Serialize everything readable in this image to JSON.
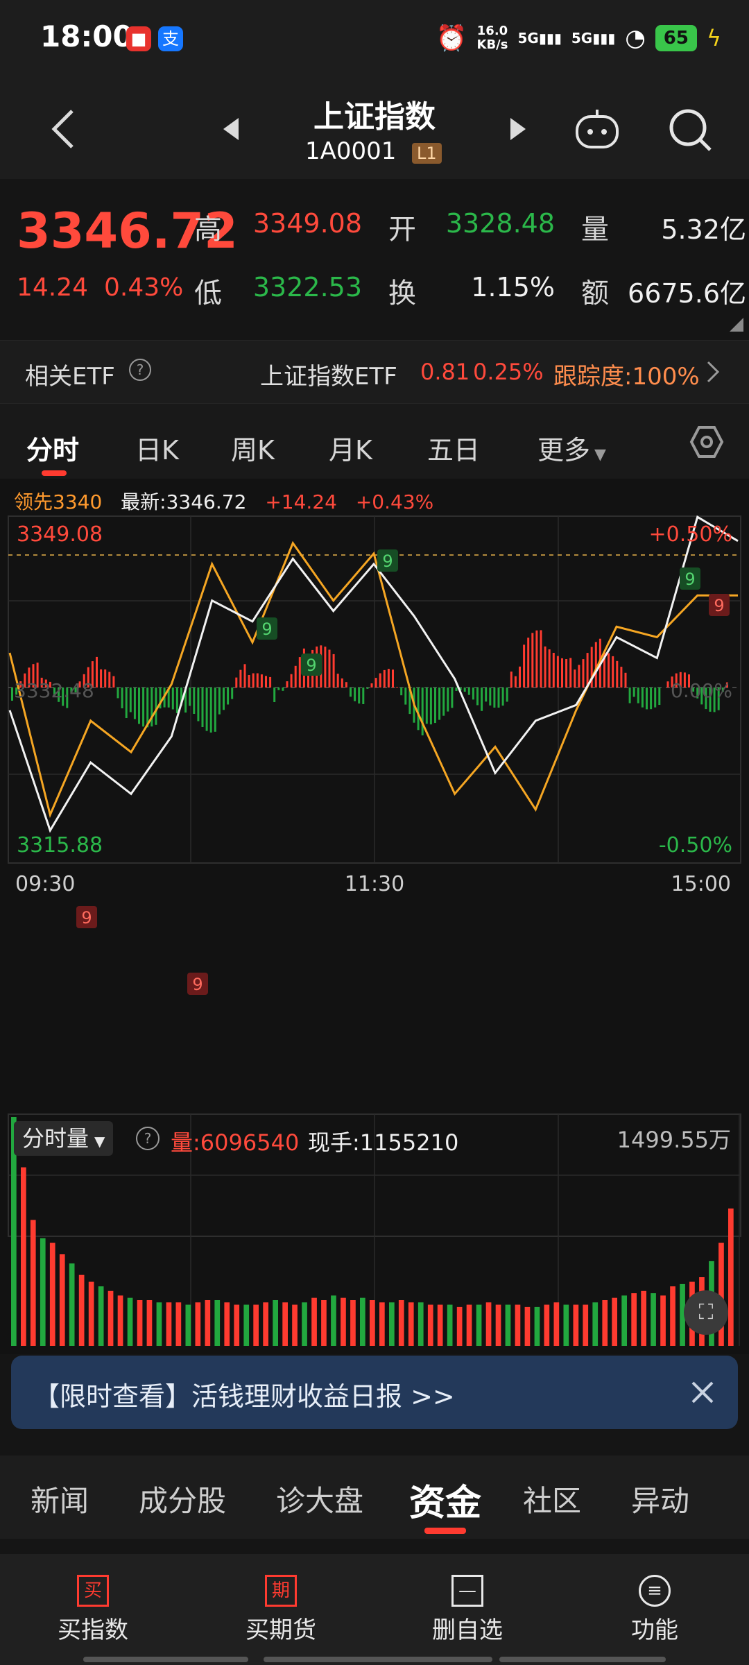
{
  "status_bar": {
    "time": "18:00",
    "speed_top": "16.0",
    "speed_unit": "KB/s",
    "net1": "5G",
    "net2": "5G",
    "battery": "65"
  },
  "header": {
    "title": "上证指数",
    "code": "1A0001",
    "level_badge": "L1"
  },
  "quote": {
    "price": "3346.72",
    "change": "14.24",
    "change_pct": "0.43%",
    "high_label": "高",
    "high": "3349.08",
    "open_label": "开",
    "open": "3328.48",
    "volume_label": "量",
    "volume": "5.32亿",
    "low_label": "低",
    "low": "3322.53",
    "turnover_label": "换",
    "turnover": "1.15%",
    "amount_label": "额",
    "amount": "6675.6亿"
  },
  "etf": {
    "label": "相关ETF",
    "name": "上证指数ETF",
    "price": "0.81",
    "pct": "0.25%",
    "tracking": "跟踪度:100%"
  },
  "tabs": [
    "分时",
    "日K",
    "周K",
    "月K",
    "五日",
    "更多"
  ],
  "chart_info": {
    "leader": "领先3340",
    "latest": "最新:3346.72",
    "change": "+14.24",
    "pct": "+0.43%",
    "y_top": "3349.08",
    "y_mid": "3332.48",
    "y_bottom": "3315.88",
    "pct_top": "+0.50%",
    "pct_mid": "0.00%",
    "pct_bottom": "-0.50%",
    "x_labels": [
      "09:30",
      "11:30",
      "15:00"
    ],
    "vol_label": "分时量",
    "vol": "量:6096540",
    "hand": "现手:1155210",
    "vol_max": "1499.55万",
    "marker": "9"
  },
  "chart_data": {
    "type": "line",
    "x": [
      "09:30",
      "11:30",
      "15:00"
    ],
    "ylim": [
      3315.88,
      3349.08
    ],
    "series": [
      {
        "values": [
          3330.5,
          3319.0,
          3325.5,
          3322.5,
          3328.0,
          3341.0,
          3339.0,
          3345.0,
          3340.0,
          3344.5,
          3339.5,
          3333.5,
          3324.5,
          3329.5,
          3331.0,
          3337.5,
          3335.5,
          3349.0,
          3346.7
        ]
      },
      {
        "values": [
          3336.0,
          3320.5,
          3329.5,
          3326.5,
          3333.0,
          3344.5,
          3337.0,
          3346.5,
          3341.0,
          3345.5,
          3331.0,
          3322.5,
          3327.0,
          3321.0,
          3330.5,
          3338.5,
          3337.5,
          3341.5,
          3341.5
        ]
      }
    ],
    "volume_bars": [
      100,
      78,
      55,
      47,
      45,
      40,
      36,
      31,
      28,
      26,
      24,
      22,
      21,
      20,
      20,
      19,
      19,
      19,
      18,
      19,
      20,
      20,
      19,
      18,
      18,
      18,
      19,
      20,
      19,
      18,
      19,
      21,
      20,
      22,
      21,
      20,
      21,
      20,
      19,
      19,
      20,
      19,
      19,
      18,
      18,
      18,
      17,
      18,
      18,
      19,
      18,
      18,
      18,
      17,
      17,
      18,
      19,
      18,
      18,
      18,
      19,
      20,
      21,
      22,
      23,
      24,
      23,
      22,
      26,
      27,
      28,
      30,
      37,
      45,
      60
    ]
  },
  "banner": {
    "text": "【限时查看】活钱理财收益日报 >>"
  },
  "sub_tabs": [
    "新闻",
    "成分股",
    "诊大盘",
    "资金",
    "社区",
    "异动"
  ],
  "bottom_nav": [
    {
      "icon": "买",
      "label": "买指数"
    },
    {
      "icon": "期",
      "label": "买期货"
    },
    {
      "icon": "—",
      "label": "删自选"
    },
    {
      "icon": "≡",
      "label": "功能"
    }
  ],
  "colors": {
    "up": "#ff4a3c",
    "down": "#2bb84a",
    "accent": "#ff9a2e"
  }
}
